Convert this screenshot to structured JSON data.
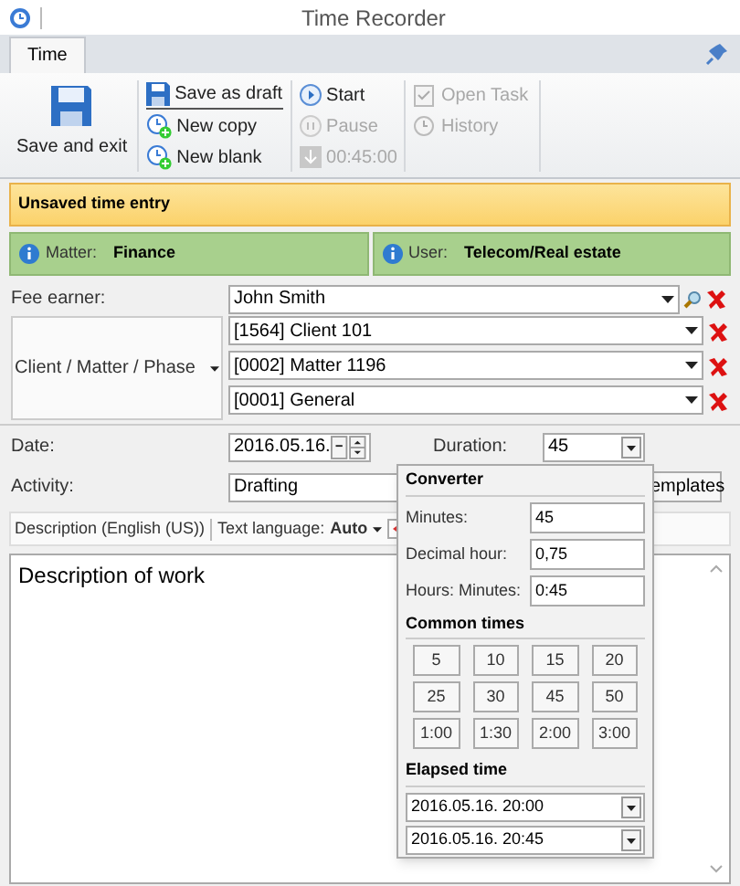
{
  "window": {
    "title": "Time Recorder"
  },
  "tabs": [
    {
      "label": "Time",
      "selected": true
    }
  ],
  "ribbon": {
    "groups": [
      [
        {
          "label": "Save and exit",
          "kind": "large",
          "disabled": false
        }
      ],
      [
        {
          "label": "Save as draft",
          "kind": "small",
          "disabled": false
        },
        {
          "label": "New copy",
          "kind": "small",
          "disabled": false
        },
        {
          "label": "New blank",
          "kind": "small",
          "disabled": false
        }
      ],
      [
        {
          "label": "Start",
          "kind": "small",
          "disabled": false
        },
        {
          "label": "Pause",
          "kind": "small",
          "disabled": true
        },
        {
          "label": "00:45:00",
          "kind": "small",
          "disabled": true
        }
      ],
      [
        {
          "label": "Open Task",
          "kind": "small",
          "disabled": true
        },
        {
          "label": "History",
          "kind": "small",
          "disabled": true
        }
      ]
    ]
  },
  "banner": {
    "text": "Unsaved time entry"
  },
  "info_bars": [
    {
      "label": "Matter:",
      "value": "Finance"
    },
    {
      "label": "User:",
      "value": "Telecom/Real estate"
    }
  ],
  "fee_earner": {
    "label": "Fee earner:",
    "value": "John Smith"
  },
  "client_matter_phase": {
    "label": "Client / Matter / Phase",
    "fields": [
      "[1564] Client 101",
      "[0002] Matter 1196",
      "[0001] General"
    ]
  },
  "date": {
    "label": "Date:",
    "value": "2016.05.16."
  },
  "duration": {
    "label": "Duration:",
    "value": "45"
  },
  "activity": {
    "label": "Activity:",
    "value": "Drafting",
    "button": "emplates"
  },
  "description_toolbar": {
    "title": "Description (English (US))",
    "language_label": "Text language:",
    "language_value": "Auto"
  },
  "description": {
    "value": "Description of work"
  },
  "converter": {
    "title": "Converter",
    "fields": [
      {
        "label": "Minutes:",
        "value": "45"
      },
      {
        "label": "Decimal hour:",
        "value": "0,75"
      },
      {
        "label": "Hours: Minutes:",
        "value": "0:45"
      }
    ],
    "common_title": "Common times",
    "common_times": [
      "5",
      "10",
      "15",
      "20",
      "25",
      "30",
      "45",
      "50",
      "1:00",
      "1:30",
      "2:00",
      "3:00"
    ],
    "elapsed_title": "Elapsed time",
    "elapsed": [
      "2016.05.16. 20:00",
      "2016.05.16. 20:45"
    ]
  }
}
